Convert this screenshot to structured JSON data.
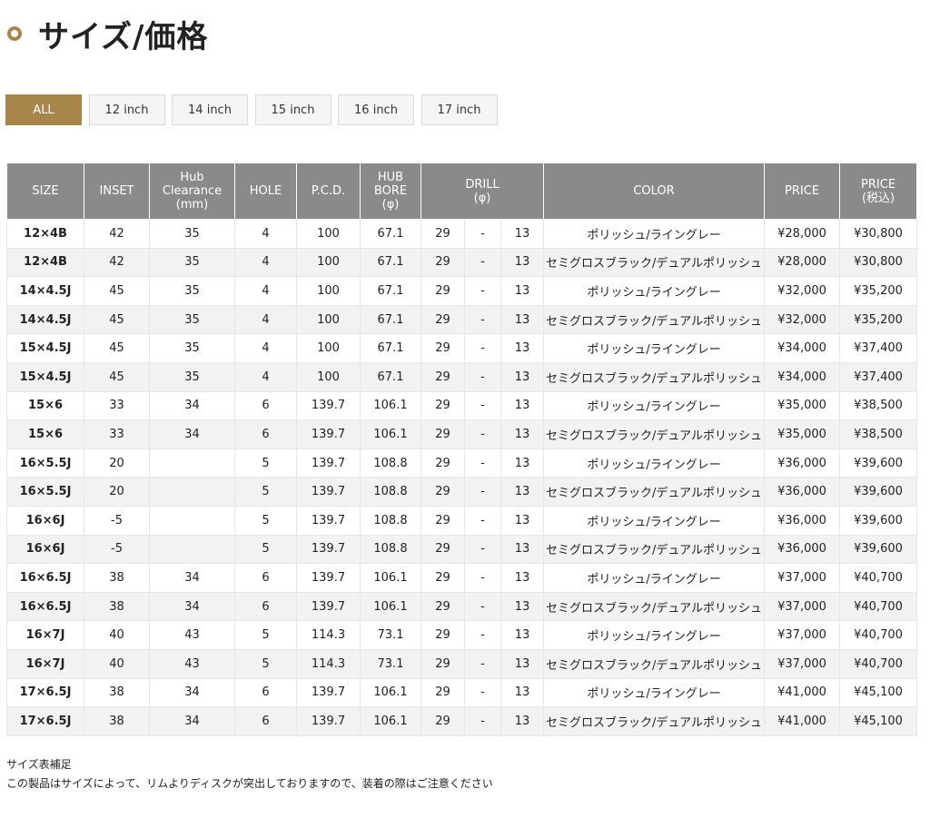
{
  "page_title": "サイズ/価格",
  "filters": [
    "ALL",
    "12 inch",
    "14 inch",
    "15 inch",
    "16 inch",
    "17 inch"
  ],
  "active_filter": "ALL",
  "table": {
    "headers": {
      "size": "SIZE",
      "inset": "INSET",
      "hub_clearance": [
        "Hub",
        "Clearance",
        "(mm)"
      ],
      "hole": "HOLE",
      "pcd": "P.C.D.",
      "hub_bore": [
        "HUB",
        "BORE",
        "(φ)"
      ],
      "drill": [
        "DRILL",
        "(φ)"
      ],
      "color": "COLOR",
      "price": "PRICE",
      "price_tax": [
        "PRICE",
        "(税込)"
      ]
    },
    "rows": [
      {
        "size": "12×4B",
        "inset": "42",
        "hub": "35",
        "hole": "4",
        "pcd": "100",
        "bore": "67.1",
        "drill_from": "29",
        "drill_sep": "-",
        "drill_to": "13",
        "color": "ポリッシュ/ライングレー",
        "price": "¥28,000",
        "price_tax": "¥30,800"
      },
      {
        "size": "12×4B",
        "inset": "42",
        "hub": "35",
        "hole": "4",
        "pcd": "100",
        "bore": "67.1",
        "drill_from": "29",
        "drill_sep": "-",
        "drill_to": "13",
        "color": "セミグロスブラック/デュアルポリッシュ",
        "price": "¥28,000",
        "price_tax": "¥30,800"
      },
      {
        "size": "14×4.5J",
        "inset": "45",
        "hub": "35",
        "hole": "4",
        "pcd": "100",
        "bore": "67.1",
        "drill_from": "29",
        "drill_sep": "-",
        "drill_to": "13",
        "color": "ポリッシュ/ライングレー",
        "price": "¥32,000",
        "price_tax": "¥35,200"
      },
      {
        "size": "14×4.5J",
        "inset": "45",
        "hub": "35",
        "hole": "4",
        "pcd": "100",
        "bore": "67.1",
        "drill_from": "29",
        "drill_sep": "-",
        "drill_to": "13",
        "color": "セミグロスブラック/デュアルポリッシュ",
        "price": "¥32,000",
        "price_tax": "¥35,200"
      },
      {
        "size": "15×4.5J",
        "inset": "45",
        "hub": "35",
        "hole": "4",
        "pcd": "100",
        "bore": "67.1",
        "drill_from": "29",
        "drill_sep": "-",
        "drill_to": "13",
        "color": "ポリッシュ/ライングレー",
        "price": "¥34,000",
        "price_tax": "¥37,400"
      },
      {
        "size": "15×4.5J",
        "inset": "45",
        "hub": "35",
        "hole": "4",
        "pcd": "100",
        "bore": "67.1",
        "drill_from": "29",
        "drill_sep": "-",
        "drill_to": "13",
        "color": "セミグロスブラック/デュアルポリッシュ",
        "price": "¥34,000",
        "price_tax": "¥37,400"
      },
      {
        "size": "15×6",
        "inset": "33",
        "hub": "34",
        "hole": "6",
        "pcd": "139.7",
        "bore": "106.1",
        "drill_from": "29",
        "drill_sep": "-",
        "drill_to": "13",
        "color": "ポリッシュ/ライングレー",
        "price": "¥35,000",
        "price_tax": "¥38,500"
      },
      {
        "size": "15×6",
        "inset": "33",
        "hub": "34",
        "hole": "6",
        "pcd": "139.7",
        "bore": "106.1",
        "drill_from": "29",
        "drill_sep": "-",
        "drill_to": "13",
        "color": "セミグロスブラック/デュアルポリッシュ",
        "price": "¥35,000",
        "price_tax": "¥38,500"
      },
      {
        "size": "16×5.5J",
        "inset": "20",
        "hub": "",
        "hole": "5",
        "pcd": "139.7",
        "bore": "108.8",
        "drill_from": "29",
        "drill_sep": "-",
        "drill_to": "13",
        "color": "ポリッシュ/ライングレー",
        "price": "¥36,000",
        "price_tax": "¥39,600"
      },
      {
        "size": "16×5.5J",
        "inset": "20",
        "hub": "",
        "hole": "5",
        "pcd": "139.7",
        "bore": "108.8",
        "drill_from": "29",
        "drill_sep": "-",
        "drill_to": "13",
        "color": "セミグロスブラック/デュアルポリッシュ",
        "price": "¥36,000",
        "price_tax": "¥39,600"
      },
      {
        "size": "16×6J",
        "inset": "-5",
        "hub": "",
        "hole": "5",
        "pcd": "139.7",
        "bore": "108.8",
        "drill_from": "29",
        "drill_sep": "-",
        "drill_to": "13",
        "color": "ポリッシュ/ライングレー",
        "price": "¥36,000",
        "price_tax": "¥39,600"
      },
      {
        "size": "16×6J",
        "inset": "-5",
        "hub": "",
        "hole": "5",
        "pcd": "139.7",
        "bore": "108.8",
        "drill_from": "29",
        "drill_sep": "-",
        "drill_to": "13",
        "color": "セミグロスブラック/デュアルポリッシュ",
        "price": "¥36,000",
        "price_tax": "¥39,600"
      },
      {
        "size": "16×6.5J",
        "inset": "38",
        "hub": "34",
        "hole": "6",
        "pcd": "139.7",
        "bore": "106.1",
        "drill_from": "29",
        "drill_sep": "-",
        "drill_to": "13",
        "color": "ポリッシュ/ライングレー",
        "price": "¥37,000",
        "price_tax": "¥40,700"
      },
      {
        "size": "16×6.5J",
        "inset": "38",
        "hub": "34",
        "hole": "6",
        "pcd": "139.7",
        "bore": "106.1",
        "drill_from": "29",
        "drill_sep": "-",
        "drill_to": "13",
        "color": "セミグロスブラック/デュアルポリッシュ",
        "price": "¥37,000",
        "price_tax": "¥40,700"
      },
      {
        "size": "16×7J",
        "inset": "40",
        "hub": "43",
        "hole": "5",
        "pcd": "114.3",
        "bore": "73.1",
        "drill_from": "29",
        "drill_sep": "-",
        "drill_to": "13",
        "color": "ポリッシュ/ライングレー",
        "price": "¥37,000",
        "price_tax": "¥40,700"
      },
      {
        "size": "16×7J",
        "inset": "40",
        "hub": "43",
        "hole": "5",
        "pcd": "114.3",
        "bore": "73.1",
        "drill_from": "29",
        "drill_sep": "-",
        "drill_to": "13",
        "color": "セミグロスブラック/デュアルポリッシュ",
        "price": "¥37,000",
        "price_tax": "¥40,700"
      },
      {
        "size": "17×6.5J",
        "inset": "38",
        "hub": "34",
        "hole": "6",
        "pcd": "139.7",
        "bore": "106.1",
        "drill_from": "29",
        "drill_sep": "-",
        "drill_to": "13",
        "color": "ポリッシュ/ライングレー",
        "price": "¥41,000",
        "price_tax": "¥45,100"
      },
      {
        "size": "17×6.5J",
        "inset": "38",
        "hub": "34",
        "hole": "6",
        "pcd": "139.7",
        "bore": "106.1",
        "drill_from": "29",
        "drill_sep": "-",
        "drill_to": "13",
        "color": "セミグロスブラック/デュアルポリッシュ",
        "price": "¥41,000",
        "price_tax": "¥45,100"
      }
    ]
  },
  "notes": {
    "heading": "サイズ表補足",
    "body": "この製品はサイズによって、リムよりディスクが突出しておりますので、装着の際はご注意ください"
  },
  "colors": {
    "accent": "#a8864a",
    "header_bg": "#8a8a8a",
    "row_alt": "#f2f2f2"
  }
}
